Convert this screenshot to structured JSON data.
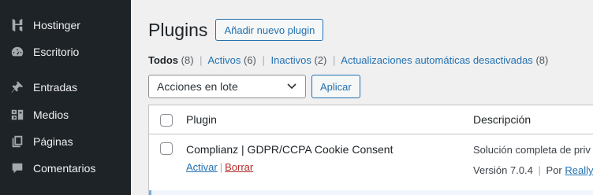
{
  "sidebar": {
    "items": [
      {
        "label": "Hostinger",
        "icon": "hostinger-icon"
      },
      {
        "label": "Escritorio",
        "icon": "dashboard-icon"
      },
      {
        "label": "Entradas",
        "icon": "pin-icon"
      },
      {
        "label": "Medios",
        "icon": "media-icon"
      },
      {
        "label": "Páginas",
        "icon": "pages-icon"
      },
      {
        "label": "Comentarios",
        "icon": "comments-icon"
      }
    ]
  },
  "header": {
    "title": "Plugins",
    "add_new_label": "Añadir nuevo plugin"
  },
  "filters": [
    {
      "label": "Todos",
      "count": "(8)"
    },
    {
      "label": "Activos",
      "count": "(6)"
    },
    {
      "label": "Inactivos",
      "count": "(2)"
    },
    {
      "label": "Actualizaciones automáticas desactivadas",
      "count": "(8)"
    }
  ],
  "bulk": {
    "selected": "Acciones en lote",
    "apply_label": "Aplicar"
  },
  "table": {
    "columns": [
      "Plugin",
      "Descripción"
    ],
    "rows": [
      {
        "name": "Complianz | GDPR/CCPA Cookie Consent",
        "actions": [
          "Activar",
          "Borrar"
        ],
        "description": "Solución completa de priv",
        "version": "Versión 7.0.4",
        "by": "Por",
        "author": "Really"
      }
    ]
  },
  "colors": {
    "sidebar_bg": "#1d2327",
    "link": "#2271b1",
    "delete": "#b32d2e"
  }
}
